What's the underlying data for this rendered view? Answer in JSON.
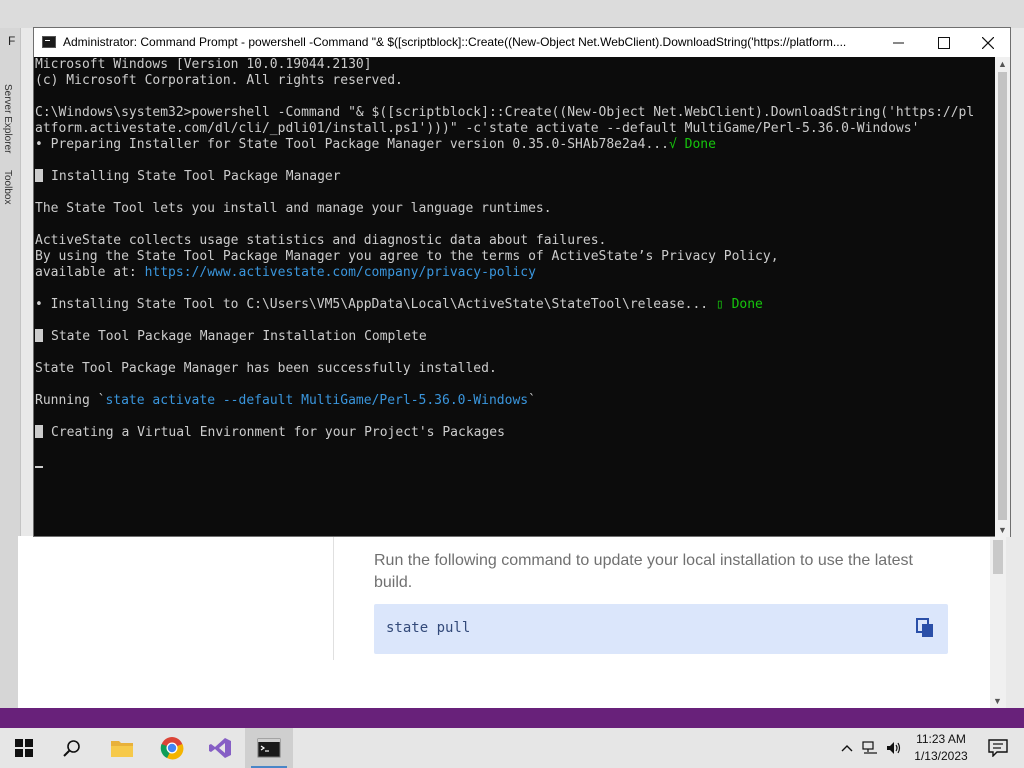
{
  "background": {
    "fn_label": "F",
    "vtab_server_explorer": "Server Explorer",
    "vtab_toolbox": "Toolbox",
    "browser_description": "Run the following command to update your local installation to use the latest build.",
    "browser_command": "state pull"
  },
  "console": {
    "title": "Administrator:  Command Prompt - powershell  -Command \"& $([scriptblock]::Create((New-Object Net.WebClient).DownloadString('https://platform....",
    "lines": {
      "l1": "Microsoft Windows [Version 10.0.19044.2130]",
      "l2": "(c) Microsoft Corporation. All rights reserved.",
      "l3": "C:\\Windows\\system32>powershell -Command \"& $([scriptblock]::Create((New-Object Net.WebClient).DownloadString('https://pl",
      "l4": "atform.activestate.com/dl/cli/_pdli01/install.ps1')))\" -c'state activate --default MultiGame/Perl-5.36.0-Windows'",
      "l5": "• Preparing Installer for State Tool Package Manager version 0.35.0-SHAb78e2a4...",
      "l5_done": "√ Done",
      "l6": "Installing State Tool Package Manager",
      "l7": "The State Tool lets you install and manage your language runtimes.",
      "l8": "ActiveState collects usage statistics and diagnostic data about failures.",
      "l9": "By using the State Tool Package Manager you agree to the terms of ActiveState’s Privacy Policy,",
      "l10_prefix": "available at: ",
      "l10_link": "https://www.activestate.com/company/privacy-policy",
      "l11": "• Installing State Tool to C:\\Users\\VM5\\AppData\\Local\\ActiveState\\StateTool\\release... ",
      "l11_done": "▯ Done",
      "l12": "State Tool Package Manager Installation Complete",
      "l13": "State Tool Package Manager has been successfully installed.",
      "l14_prefix": "Running `",
      "l14_cmd": "state activate --default MultiGame/Perl-5.36.0-Windows",
      "l14_suffix": "`",
      "l15": "Creating a Virtual Environment for your Project's Packages"
    }
  },
  "taskbar": {
    "time": "11:23 AM",
    "date": "1/13/2023",
    "apps": [
      "start-icon",
      "search-icon",
      "file-explorer-icon",
      "chrome-icon",
      "visual-studio-icon",
      "command-prompt-icon"
    ]
  },
  "colors": {
    "console_bg": "#0c0c0c",
    "console_text": "#cccccc",
    "success_green": "#16c60c",
    "link_blue": "#3a96dd",
    "vs_purple": "#68217a"
  }
}
